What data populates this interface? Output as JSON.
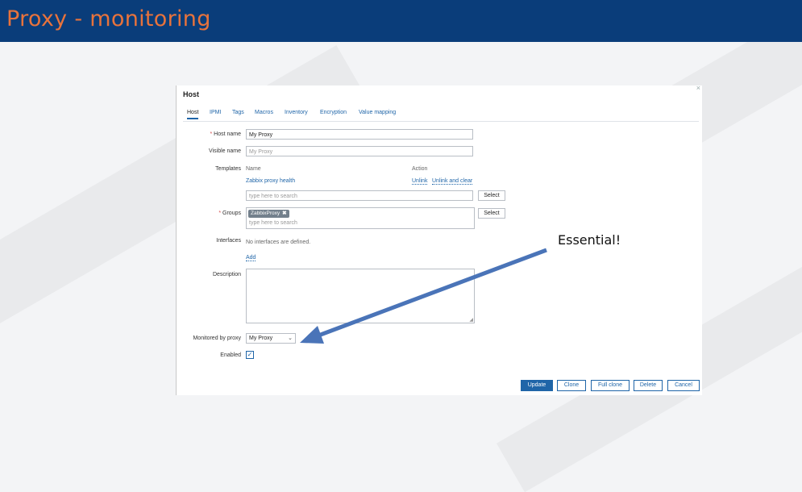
{
  "slide": {
    "title": "Proxy - monitoring",
    "annotation": "Essential!"
  },
  "dialog": {
    "title": "Host",
    "close": "×",
    "tabs": [
      "Host",
      "IPMI",
      "Tags",
      "Macros",
      "Inventory",
      "Encryption",
      "Value mapping"
    ],
    "form": {
      "host_name_label": "Host name",
      "host_name_value": "My Proxy",
      "visible_name_label": "Visible name",
      "visible_name_placeholder": "My Proxy",
      "templates_label": "Templates",
      "templates_col_name": "Name",
      "templates_col_action": "Action",
      "template_item": "Zabbix proxy health",
      "unlink": "Unlink",
      "unlink_clear": "Unlink and clear",
      "template_search_placeholder": "type here to search",
      "select": "Select",
      "groups_label": "Groups",
      "group_chip": "ZabbixProxy",
      "group_chip_remove": "✖",
      "groups_search_placeholder": "type here to search",
      "interfaces_label": "Interfaces",
      "no_interfaces": "No interfaces are defined.",
      "add": "Add",
      "description_label": "Description",
      "monitored_by_label": "Monitored by proxy",
      "monitored_by_value": "My Proxy",
      "enabled_label": "Enabled",
      "enabled_check": "✓",
      "required_mark": "*"
    },
    "actions": [
      "Update",
      "Clone",
      "Full clone",
      "Delete",
      "Cancel"
    ]
  },
  "colors": {
    "header": "#0a3d7a",
    "title": "#e8733c",
    "link": "#1f65a8",
    "arrow": "#4a74b8"
  }
}
